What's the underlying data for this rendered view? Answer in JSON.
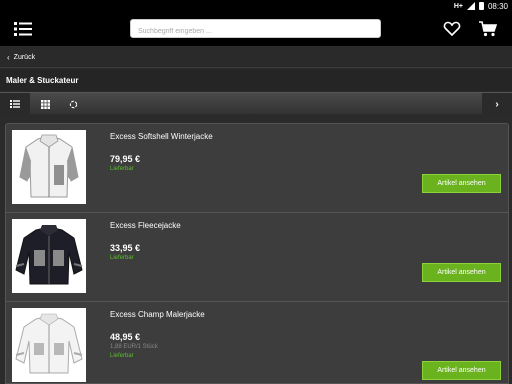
{
  "status_bar": {
    "network": "H+",
    "time": "08:30"
  },
  "header": {
    "search_placeholder": "Suchbegriff eingeben ...",
    "icons": [
      "menu-icon",
      "heart-icon",
      "cart-icon"
    ]
  },
  "nav": {
    "back_label": "Zurück"
  },
  "category": {
    "title": "Maler & Stuckateur"
  },
  "view_bar": {
    "icons": [
      "list-view-icon",
      "grid-view-icon",
      "refresh-icon",
      "chevron-right-icon"
    ]
  },
  "products": [
    {
      "name": "Excess Softshell Winterjacke",
      "price": "79,95 €",
      "unit_price": "",
      "stock": "Lieferbar",
      "button": "Artikel ansehen"
    },
    {
      "name": "Excess Fleecejacke",
      "price": "33,95 €",
      "unit_price": "",
      "stock": "Lieferbar",
      "button": "Artikel ansehen"
    },
    {
      "name": "Excess Champ Malerjacke",
      "price": "48,95 €",
      "unit_price": "1,88 EUR/1 Stück",
      "stock": "Lieferbar",
      "button": "Artikel ansehen"
    }
  ],
  "colors": {
    "accent": "#6ab31e",
    "stock": "#59c02b",
    "background": "#2b2b2b"
  }
}
